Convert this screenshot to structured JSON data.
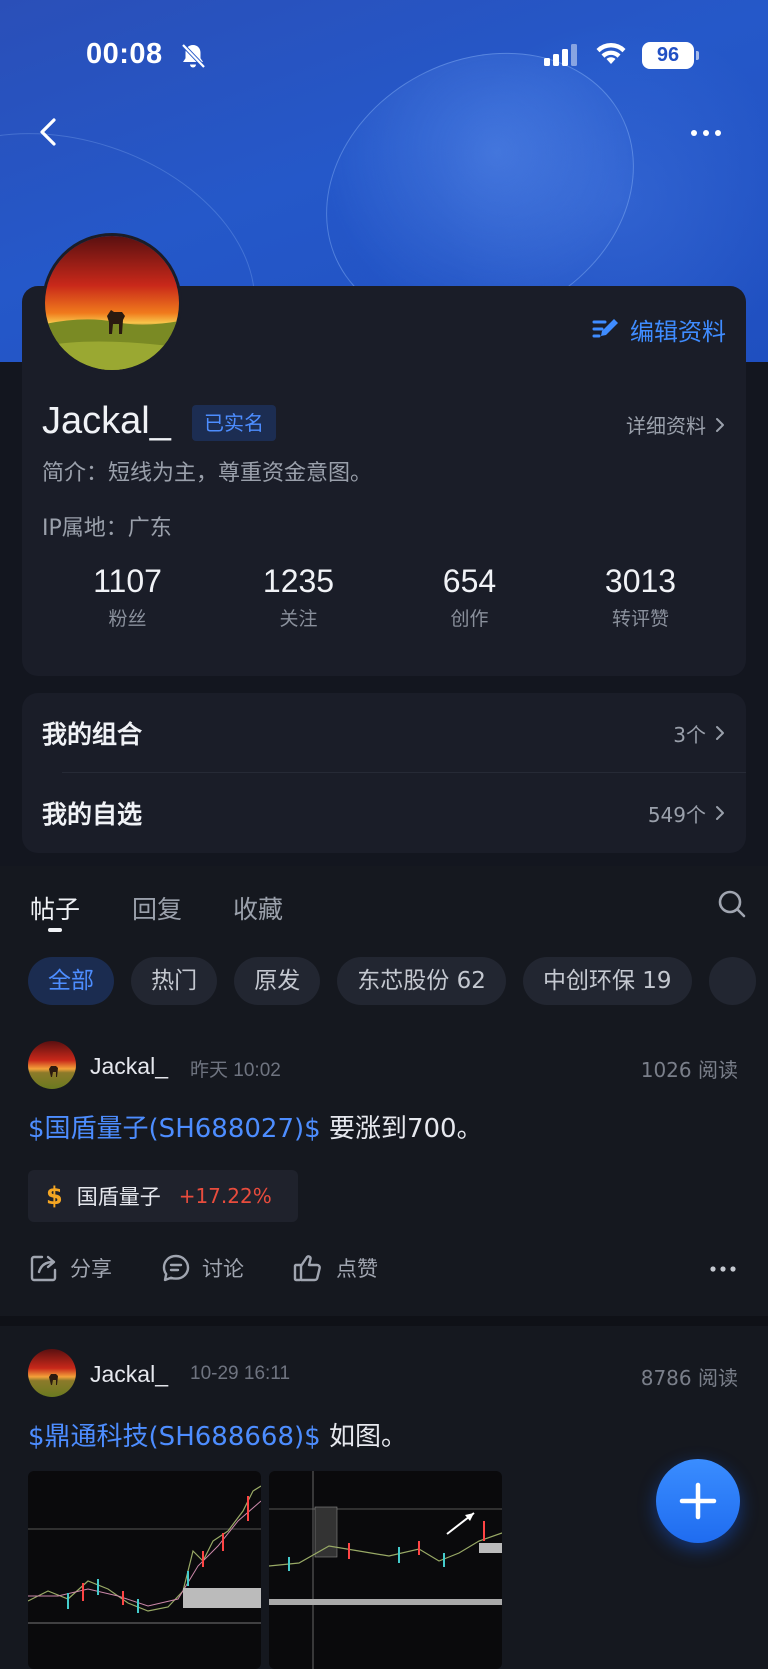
{
  "status_bar": {
    "time": "00:08",
    "battery": "96"
  },
  "profile": {
    "edit_label": "编辑资料",
    "username": "Jackal_",
    "verified_badge": "已实名",
    "detail_link": "详细资料",
    "bio": "简介：短线为主，尊重资金意图。",
    "ip_location": "IP属地：广东",
    "stats": [
      {
        "value": "1107",
        "label": "粉丝"
      },
      {
        "value": "1235",
        "label": "关注"
      },
      {
        "value": "654",
        "label": "创作"
      },
      {
        "value": "3013",
        "label": "转评赞"
      }
    ]
  },
  "lists": [
    {
      "title": "我的组合",
      "count": "3个"
    },
    {
      "title": "我的自选",
      "count": "549个"
    }
  ],
  "tabs": [
    "帖子",
    "回复",
    "收藏"
  ],
  "active_tab": "帖子",
  "chips": [
    "全部",
    "热门",
    "原发",
    "东芯股份 62",
    "中创环保 19"
  ],
  "posts": [
    {
      "author": "Jackal_",
      "time": "昨天 10:02",
      "reads": "1026 阅读",
      "stock_tag": "$国盾量子(SH688027)$",
      "text": " 要涨到700。",
      "stock_chip": {
        "name": "国盾量子",
        "change": "+17.22%"
      },
      "actions": [
        "分享",
        "讨论",
        "点赞"
      ]
    },
    {
      "author": "Jackal_",
      "time": "10-29 16:11",
      "reads": "8786 阅读",
      "stock_tag": "$鼎通科技(SH688668)$",
      "text": " 如图。"
    }
  ],
  "colors": {
    "accent": "#3f8cff",
    "up": "#e84c3d",
    "banner": "#2558c9",
    "card": "#1a1d28"
  }
}
